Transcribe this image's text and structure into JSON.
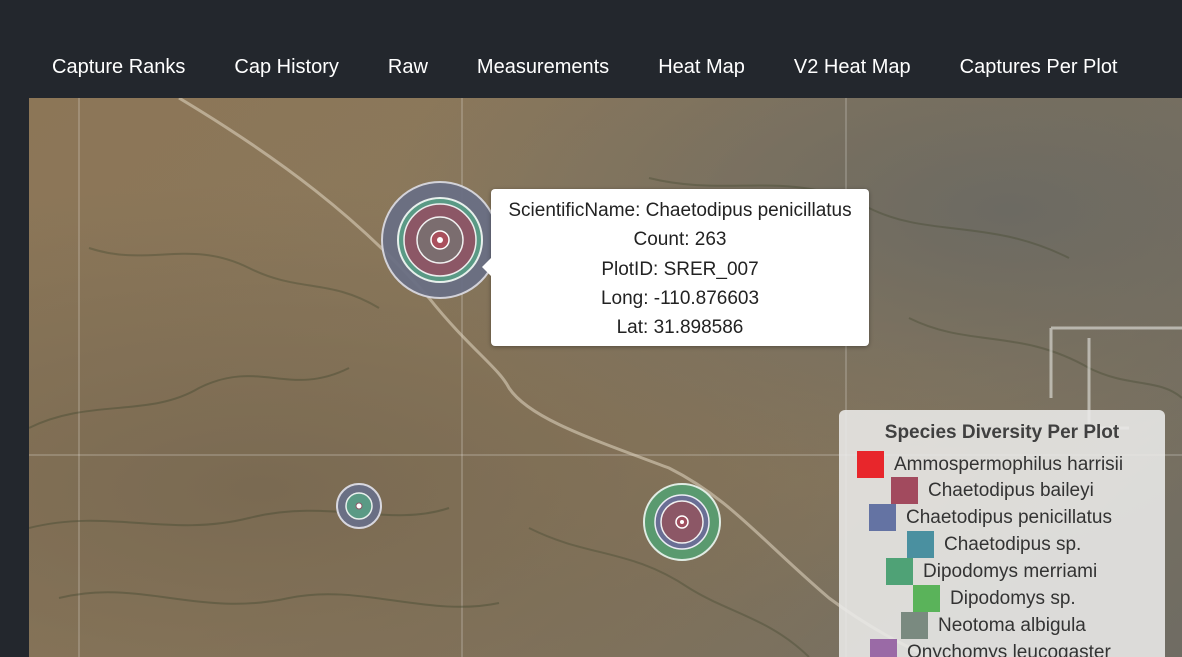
{
  "nav": {
    "tabs": [
      {
        "label": "Capture Ranks"
      },
      {
        "label": "Cap History"
      },
      {
        "label": "Raw"
      },
      {
        "label": "Measurements"
      },
      {
        "label": "Heat Map"
      },
      {
        "label": "V2 Heat Map"
      },
      {
        "label": "Captures Per Plot"
      }
    ]
  },
  "tooltip": {
    "scientific_name": "ScientificName: Chaetodipus penicillatus",
    "count": "Count: 263",
    "plot_id": "PlotID: SRER_007",
    "long": "Long: -110.876603",
    "lat": "Lat: 31.898586"
  },
  "legend": {
    "title": "Species Diversity Per Plot",
    "items": [
      {
        "label": "Ammospermophilus harrisii",
        "color": "#e8262b"
      },
      {
        "label": "Chaetodipus baileyi",
        "color": "#a24a5e"
      },
      {
        "label": "Chaetodipus penicillatus",
        "color": "#6473a3"
      },
      {
        "label": "Chaetodipus sp.",
        "color": "#4a90a0"
      },
      {
        "label": "Dipodomys merriami",
        "color": "#4fa276"
      },
      {
        "label": "Dipodomys sp.",
        "color": "#5ab35a"
      },
      {
        "label": "Neotoma albigula",
        "color": "#7a8a80"
      },
      {
        "label": "Onychomys leucogaster",
        "color": "#9a6aa6"
      }
    ]
  },
  "colors": {
    "header_bg": "#23272d",
    "tab_text": "#ffffff"
  }
}
